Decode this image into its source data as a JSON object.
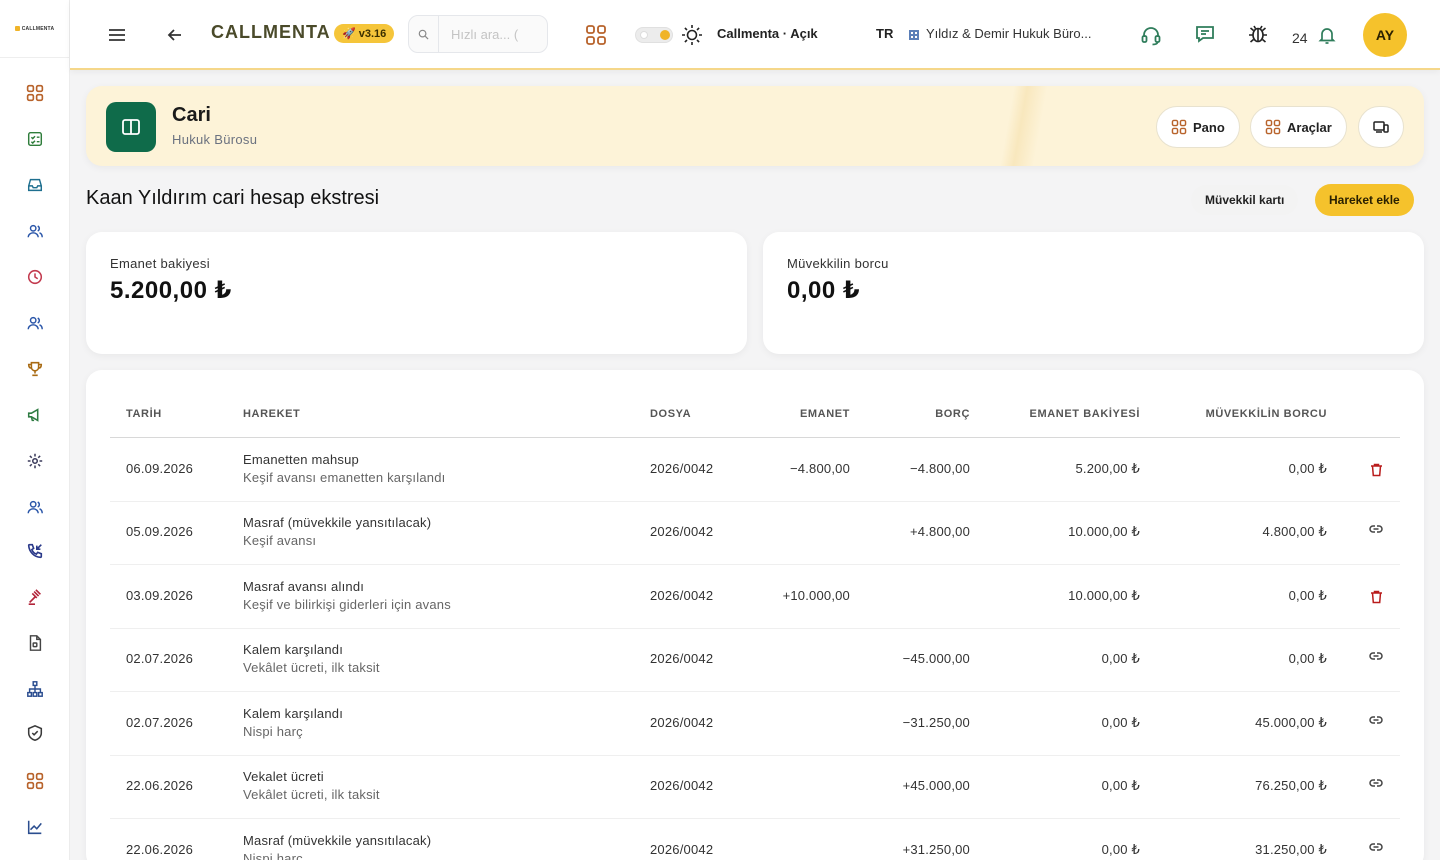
{
  "sidebar": {
    "logo_text": "CALLMENTA",
    "items": [
      {
        "icon": "grid-icon",
        "color": "#b8632b"
      },
      {
        "icon": "checklist-icon",
        "color": "#2f7d3b"
      },
      {
        "icon": "inbox-icon",
        "color": "#1e6f8f"
      },
      {
        "icon": "users-icon",
        "color": "#2955a8"
      },
      {
        "icon": "clock-icon",
        "color": "#c23a4e"
      },
      {
        "icon": "users-icon",
        "color": "#2955a8"
      },
      {
        "icon": "trophy-icon",
        "color": "#a86a12"
      },
      {
        "icon": "megaphone-icon",
        "color": "#2e7b42"
      },
      {
        "icon": "gear-icon",
        "color": "#3a3a5a"
      },
      {
        "icon": "users-icon",
        "color": "#2955a8"
      },
      {
        "icon": "phone-icon",
        "color": "#2b3a8a"
      },
      {
        "icon": "gavel-icon",
        "color": "#b2243a"
      },
      {
        "icon": "document-icon",
        "color": "#444"
      },
      {
        "icon": "hierarchy-icon",
        "color": "#2a4d8f"
      },
      {
        "icon": "shield-icon",
        "color": "#3a3a3a"
      },
      {
        "icon": "grid-icon",
        "color": "#b8632b"
      },
      {
        "icon": "chart-icon",
        "color": "#2a4d8f"
      }
    ]
  },
  "topbar": {
    "brand": "CALLMENTA",
    "version": "v3.16",
    "search_placeholder": "Hızlı ara... (",
    "theme_label": "Callmenta · Açık",
    "language": "TR",
    "organization": "Yıldız & Demir Hukuk Büro...",
    "notification_count": "24",
    "avatar_initials": "AY",
    "accent_color": "#f5c22c"
  },
  "header": {
    "title": "Cari",
    "subtitle": "Hukuk Bürosu",
    "buttons": {
      "pano": "Pano",
      "araclar": "Araçlar"
    }
  },
  "page": {
    "title": "Kaan Yıldırım cari hesap ekstresi",
    "client_card_label": "Müvekkil kartı",
    "add_transaction_label": "Hareket ekle"
  },
  "stats": {
    "trust_balance": {
      "label": "Emanet bakiyesi",
      "value": "5.200,00 ₺"
    },
    "client_debt": {
      "label": "Müvekkilin borcu",
      "value": "0,00 ₺"
    }
  },
  "table": {
    "headers": {
      "date": "TARİH",
      "transaction": "HAREKET",
      "file": "DOSYA",
      "trust": "EMANET",
      "debt": "BORÇ",
      "trust_balance": "EMANET BAKİYESİ",
      "client_debt": "MÜVEKKİLİN BORCU"
    },
    "rows": [
      {
        "date": "06.09.2026",
        "title": "Emanetten mahsup",
        "desc": "Keşif avansı emanetten karşılandı",
        "file": "2026/0042",
        "trust": "−4.800,00",
        "debt": "−4.800,00",
        "trust_balance": "5.200,00 ₺",
        "client_debt": "0,00 ₺",
        "action": "trash-icon"
      },
      {
        "date": "05.09.2026",
        "title": "Masraf (müvekkile yansıtılacak)",
        "desc": "Keşif avansı",
        "file": "2026/0042",
        "trust": "",
        "debt": "+4.800,00",
        "trust_balance": "10.000,00 ₺",
        "client_debt": "4.800,00 ₺",
        "action": "link-icon"
      },
      {
        "date": "03.09.2026",
        "title": "Masraf avansı alındı",
        "desc": "Keşif ve bilirkişi giderleri için avans",
        "file": "2026/0042",
        "trust": "+10.000,00",
        "debt": "",
        "trust_balance": "10.000,00 ₺",
        "client_debt": "0,00 ₺",
        "action": "trash-icon"
      },
      {
        "date": "02.07.2026",
        "title": "Kalem karşılandı",
        "desc": "Vekâlet ücreti, ilk taksit",
        "file": "2026/0042",
        "trust": "",
        "debt": "−45.000,00",
        "trust_balance": "0,00 ₺",
        "client_debt": "0,00 ₺",
        "action": "link-icon"
      },
      {
        "date": "02.07.2026",
        "title": "Kalem karşılandı",
        "desc": "Nispi harç",
        "file": "2026/0042",
        "trust": "",
        "debt": "−31.250,00",
        "trust_balance": "0,00 ₺",
        "client_debt": "45.000,00 ₺",
        "action": "link-icon"
      },
      {
        "date": "22.06.2026",
        "title": "Vekalet ücreti",
        "desc": "Vekâlet ücreti, ilk taksit",
        "file": "2026/0042",
        "trust": "",
        "debt": "+45.000,00",
        "trust_balance": "0,00 ₺",
        "client_debt": "76.250,00 ₺",
        "action": "link-icon"
      },
      {
        "date": "22.06.2026",
        "title": "Masraf (müvekkile yansıtılacak)",
        "desc": "Nispi harç",
        "file": "2026/0042",
        "trust": "",
        "debt": "+31.250,00",
        "trust_balance": "0,00 ₺",
        "client_debt": "31.250,00 ₺",
        "action": "link-icon"
      }
    ]
  }
}
